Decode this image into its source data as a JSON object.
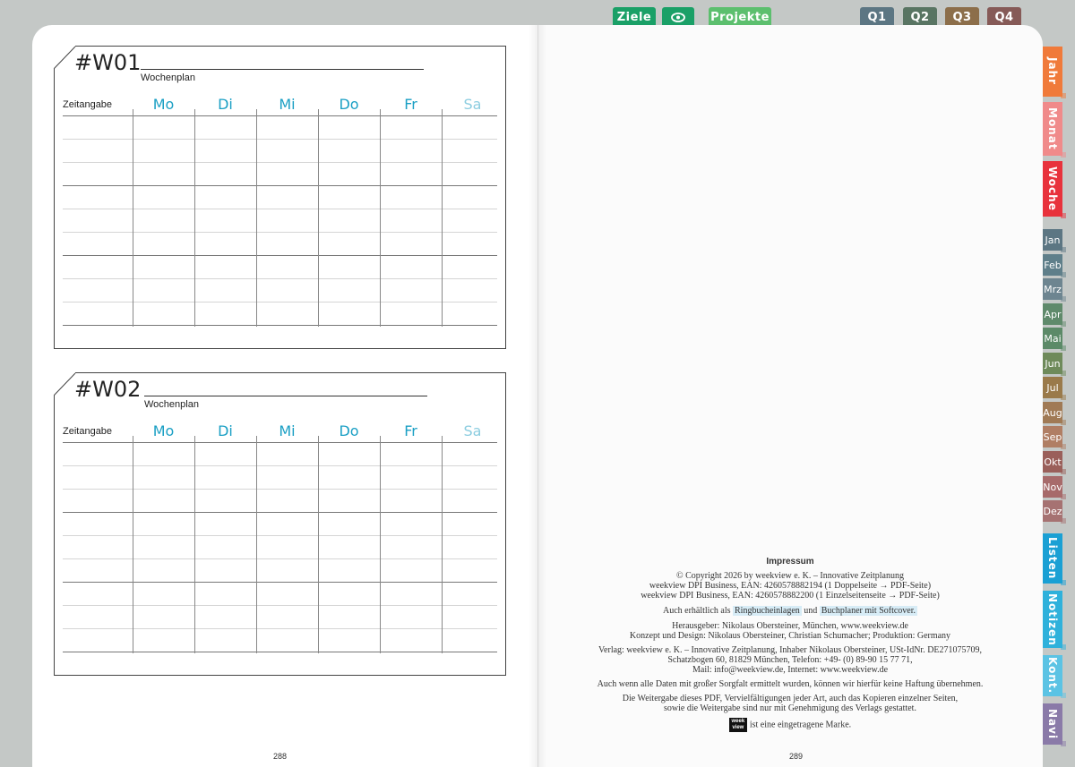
{
  "top_tabs": [
    {
      "label": "Ziele",
      "color": "#1aa067"
    },
    {
      "label": "",
      "icon": "eye-icon",
      "color": "#1aa067"
    },
    {
      "label": "Projekte",
      "color": "#5cbf6e"
    },
    {
      "label": "Q1",
      "color": "#5c7683"
    },
    {
      "label": "Q2",
      "color": "#597563"
    },
    {
      "label": "Q3",
      "color": "#8c6e4a"
    },
    {
      "label": "Q4",
      "color": "#865a57"
    }
  ],
  "left_page": {
    "weeks": [
      {
        "number": "#W01",
        "subtitle": "Wochenplan"
      },
      {
        "number": "#W02",
        "subtitle": "Wochenplan"
      }
    ],
    "time_label": "Zeitangabe",
    "days": [
      "Mo",
      "Di",
      "Mi",
      "Do",
      "Fr",
      "Sa"
    ],
    "page_number": "288"
  },
  "right_page": {
    "page_number": "289",
    "impressum": {
      "title": "Impressum",
      "copyright": "© Copyright 2026 by weekview e. K. – Innovative Zeitplanung",
      "ean1": "weekview DPI Business, EAN: 4260578882194 (1 Doppelseite → PDF-Seite)",
      "ean2": "weekview DPI Business, EAN: 4260578882200 (1 Einzelseitenseite → PDF-Seite)",
      "available_prefix": "Auch erhältlich als",
      "link1": "Ringbucheinlagen",
      "and": "und",
      "link2": "Buchplaner mit Softcover.",
      "publisher": "Herausgeber: Nikolaus Obersteiner, München, www.weekview.de",
      "design": "Konzept und Design: Nikolaus Obersteiner, Christian Schumacher; Produktion: Germany",
      "verlag1": "Verlag: weekview e. K. – Innovative Zeitplanung, Inhaber Nikolaus Obersteiner, USt-IdNr. DE271075709,",
      "verlag2": "Schatzbogen 60, 81829 München, Telefon: +49- (0) 89-90 15 77 71,",
      "verlag3": "Mail: info@weekview.de, Internet: www.weekview.de",
      "liability": "Auch wenn alle Daten mit großer Sorgfalt ermittelt wurden,  können wir hierfür keine Haftung übernehmen.",
      "copy1": "Die Weitergabe dieses PDF, Vervielfältigungen jeder Art, auch das Kopieren einzelner Seiten,",
      "copy2": "sowie die Weitergabe sind nur mit Genehmigung des Verlags gestattet.",
      "logo_top": "week",
      "logo_bottom": "view",
      "trademark": "ist eine eingetragene Marke."
    }
  },
  "side_tabs": [
    {
      "label": "Jahr",
      "color": "#f07a3a",
      "vertical": true
    },
    {
      "label": "Monat",
      "color": "#f08a8a",
      "vertical": true
    },
    {
      "label": "Woche",
      "color": "#e8323c",
      "vertical": true
    },
    {
      "label": "Jan",
      "color": "#5c7683"
    },
    {
      "label": "Feb",
      "color": "#5f7f8a"
    },
    {
      "label": "Mrz",
      "color": "#6d8590"
    },
    {
      "label": "Apr",
      "color": "#5f8a6b"
    },
    {
      "label": "Mai",
      "color": "#5c8a68"
    },
    {
      "label": "Jun",
      "color": "#6e8a5a"
    },
    {
      "label": "Jul",
      "color": "#9a7a4a"
    },
    {
      "label": "Aug",
      "color": "#a07a55"
    },
    {
      "label": "Sep",
      "color": "#b07e64"
    },
    {
      "label": "Okt",
      "color": "#9a5f5a"
    },
    {
      "label": "Nov",
      "color": "#a76a6a"
    },
    {
      "label": "Dez",
      "color": "#a67272"
    },
    {
      "label": "Listen",
      "color": "#1aa0d4",
      "vertical": true
    },
    {
      "label": "Notizen",
      "color": "#2fb1db",
      "vertical": true
    },
    {
      "label": "Kont.",
      "color": "#5bc3e4",
      "vertical": true
    },
    {
      "label": "Navi",
      "color": "#8a7aa8",
      "vertical": true
    }
  ]
}
